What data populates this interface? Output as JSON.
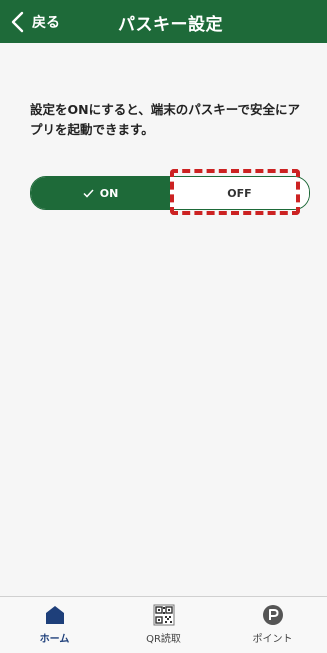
{
  "header": {
    "back_label": "戻る",
    "title": "パスキー設定"
  },
  "description": "設定をONにすると、端末のパスキーで安全にアプリを起動できます。",
  "toggle": {
    "on_label": "ON",
    "off_label": "OFF",
    "selected": "ON"
  },
  "bottom_nav": {
    "items": [
      {
        "label": "ホーム",
        "icon": "home-icon",
        "active": true
      },
      {
        "label": "QR読取",
        "icon": "qr-code-icon",
        "active": false
      },
      {
        "label": "ポイント",
        "icon": "point-icon",
        "active": false
      }
    ]
  },
  "colors": {
    "brand_green": "#1e6a39",
    "highlight_red": "#cc2222",
    "active_nav": "#1e3f7a"
  }
}
